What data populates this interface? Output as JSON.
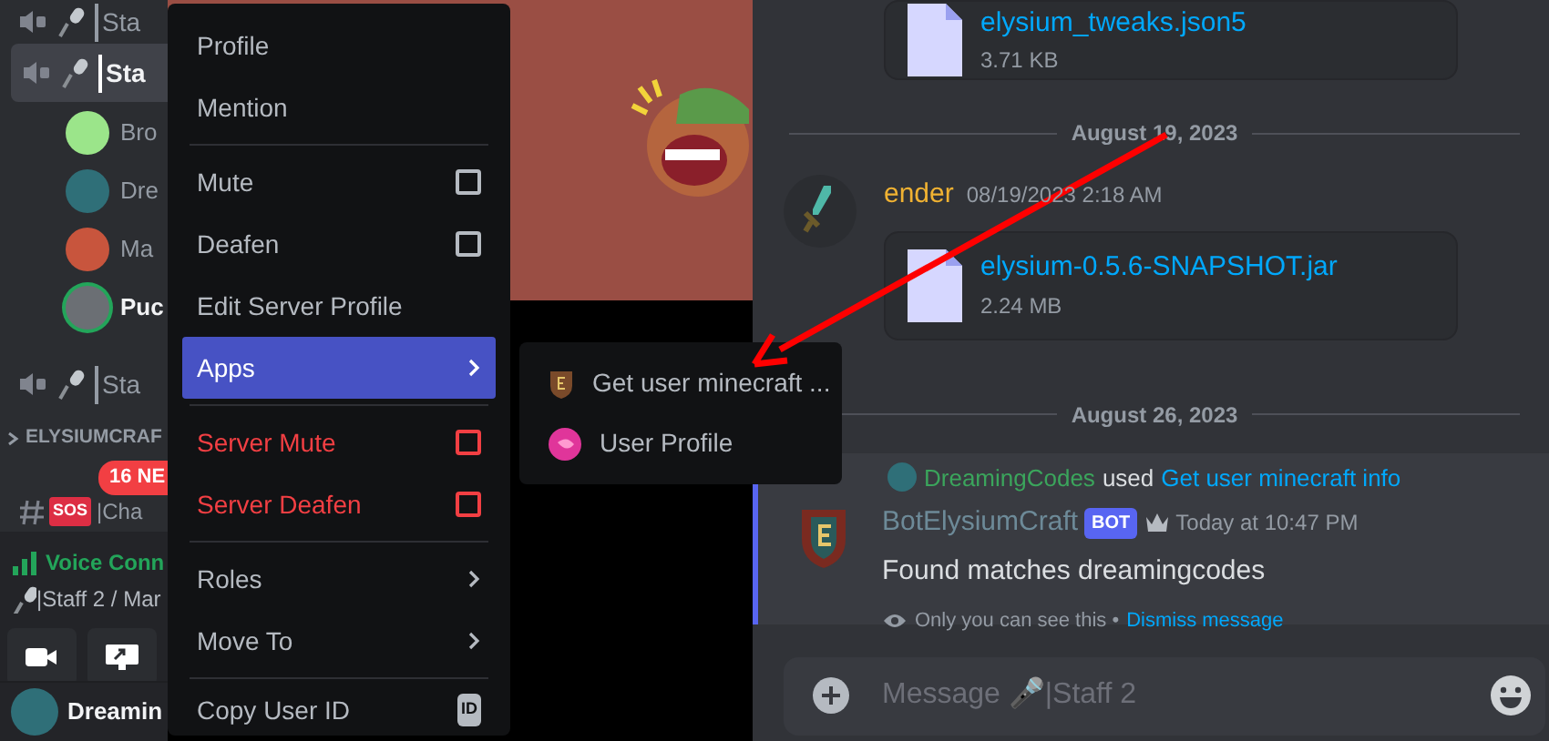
{
  "sidebar": {
    "items": [
      {
        "kind": "voice_channel",
        "label": "Sta",
        "selected": false
      },
      {
        "kind": "voice_channel",
        "label": "Sta",
        "selected": true
      },
      {
        "kind": "member",
        "label": "Bro",
        "speaking": false,
        "color": "#9be58a"
      },
      {
        "kind": "member",
        "label": "Dre",
        "speaking": false,
        "color": "#2f6f78"
      },
      {
        "kind": "member",
        "label": "Ma",
        "speaking": false,
        "color": "#c8553d"
      },
      {
        "kind": "member",
        "label": "Puc",
        "speaking": true,
        "color": "#6b6f74"
      },
      {
        "kind": "voice_channel",
        "label": "Sta",
        "selected": false
      },
      {
        "kind": "category",
        "label": "ELYSIUMCRAF"
      },
      {
        "kind": "text_channel",
        "label": "|Cha",
        "emoji": "SOS",
        "badge": "16 NE"
      }
    ]
  },
  "voice_panel": {
    "status": "Voice Conn",
    "channel": "|Staff 2 / Mar"
  },
  "user_panel": {
    "name": "Dreamin"
  },
  "context_menu": {
    "items": [
      {
        "kind": "action",
        "label": "Profile",
        "danger": false,
        "selected": false
      },
      {
        "kind": "action",
        "label": "Mention",
        "danger": false,
        "selected": false
      },
      {
        "kind": "divider"
      },
      {
        "kind": "checkbox",
        "label": "Mute",
        "danger": false,
        "selected": false,
        "checked": false
      },
      {
        "kind": "checkbox",
        "label": "Deafen",
        "danger": false,
        "selected": false,
        "checked": false
      },
      {
        "kind": "action",
        "label": "Edit Server Profile",
        "danger": false,
        "selected": false
      },
      {
        "kind": "submenu",
        "label": "Apps",
        "danger": false,
        "selected": true
      },
      {
        "kind": "divider"
      },
      {
        "kind": "checkbox",
        "label": "Server Mute",
        "danger": true,
        "selected": false,
        "checked": false
      },
      {
        "kind": "checkbox",
        "label": "Server Deafen",
        "danger": true,
        "selected": false,
        "checked": false
      },
      {
        "kind": "divider"
      },
      {
        "kind": "submenu",
        "label": "Roles",
        "danger": false,
        "selected": false
      },
      {
        "kind": "submenu",
        "label": "Move To",
        "danger": false,
        "selected": false
      },
      {
        "kind": "divider"
      },
      {
        "kind": "copy",
        "label": "Copy User ID",
        "danger": false,
        "selected": false,
        "tag": "ID"
      }
    ]
  },
  "apps_submenu": {
    "items": [
      {
        "kind": "bot",
        "label": "Get user minecraft ..."
      },
      {
        "kind": "profile",
        "label": "User Profile"
      }
    ]
  },
  "chat": {
    "messages": [
      {
        "kind": "attachment_only",
        "file": "elysium_tweaks.json5",
        "size": "3.71 KB"
      },
      {
        "kind": "date",
        "label": "August 19, 2023"
      },
      {
        "kind": "user",
        "author": "ender",
        "time": "08/19/2023 2:18 AM",
        "file": "elysium-0.5.6-SNAPSHOT.jar",
        "size": "2.24 MB"
      },
      {
        "kind": "date",
        "label": "August 26, 2023"
      },
      {
        "kind": "interaction",
        "invoker": "DreamingCodes",
        "used": "used",
        "command": "Get user minecraft info",
        "author": "BotElysiumCraft",
        "tag": "BOT",
        "time": "Today at 10:47 PM",
        "text": "Found matches dreamingcodes",
        "notice": "Only you can see this •",
        "dismiss": "Dismiss message"
      }
    ],
    "composer": {
      "placeholder": "Message 🎤|Staff 2"
    }
  }
}
